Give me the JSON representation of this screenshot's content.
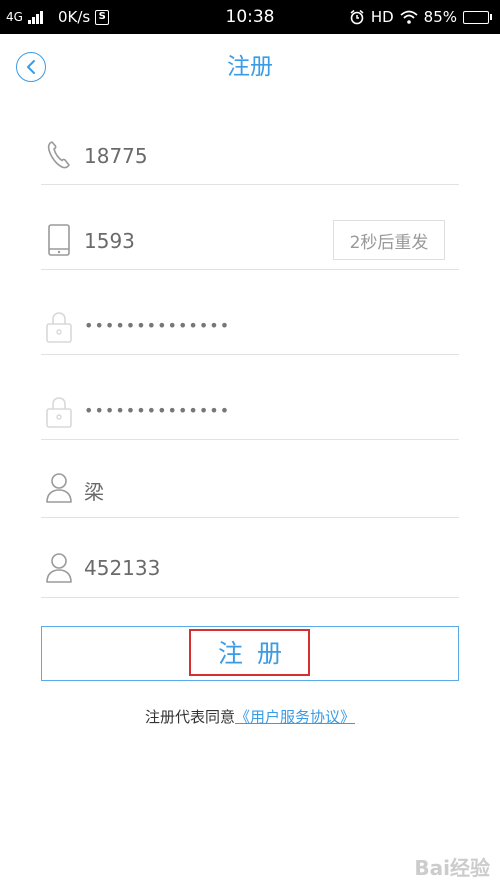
{
  "status_bar": {
    "network": "4G",
    "speed": "0K/s",
    "time": "10:38",
    "hd": "HD",
    "battery": "85%",
    "battery_level": 0.85
  },
  "header": {
    "title": "注册"
  },
  "form": {
    "phone": "18775",
    "code": "1593",
    "resend_label": "2秒后重发",
    "password": "••••••••••••••",
    "password_confirm": "••••••••••••••",
    "name": "梁",
    "id_number": "452133"
  },
  "register_button": {
    "label": "注册"
  },
  "agreement": {
    "prefix": "注册代表同意",
    "link": "《用户服务协议》"
  },
  "watermark": "Bai经验",
  "colors": {
    "accent": "#3a9be6",
    "highlight": "#d63030",
    "divider": "#e2e2e2"
  }
}
